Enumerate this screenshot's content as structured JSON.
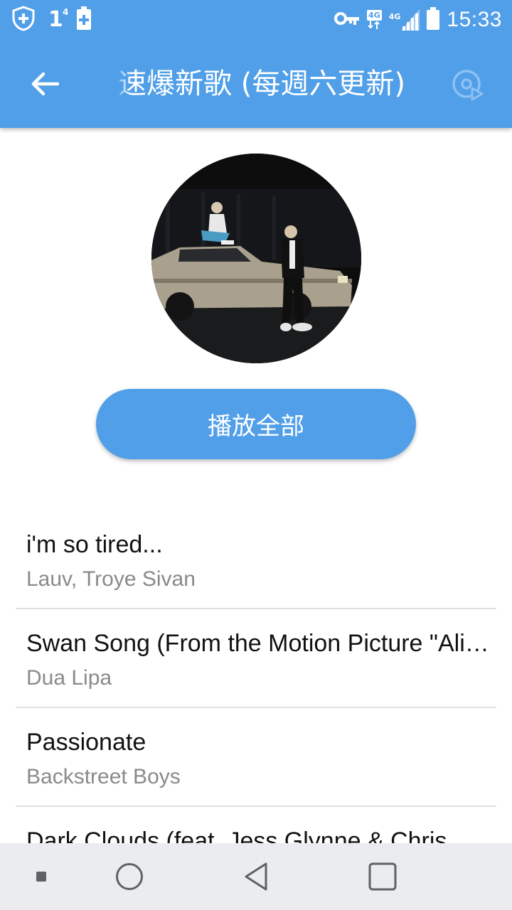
{
  "status_bar": {
    "notification_count": "1",
    "notification_superscript": "4",
    "network_label_1": "4G",
    "network_label_2": "4G",
    "time": "15:33"
  },
  "header": {
    "title": "速爆新歌 (每週六更新)",
    "accent_color": "#519fe8"
  },
  "play_all_label": "播放全部",
  "songs": [
    {
      "title": "i'm so tired...",
      "artist": "Lauv, Troye Sivan"
    },
    {
      "title": "Swan Song (From the Motion Picture \"Alita: Battle Angel\")",
      "artist": "Dua Lipa"
    },
    {
      "title": "Passionate",
      "artist": "Backstreet Boys"
    },
    {
      "title": "Dark Clouds (feat. Jess Glynne & Chris",
      "artist": ""
    }
  ],
  "icons": {
    "back": "arrow-left-icon",
    "cast": "cast-icon",
    "nav_dot": "square-dot-icon",
    "nav_home": "circle-home-icon",
    "nav_back": "triangle-back-icon",
    "nav_recents": "square-recents-icon"
  }
}
